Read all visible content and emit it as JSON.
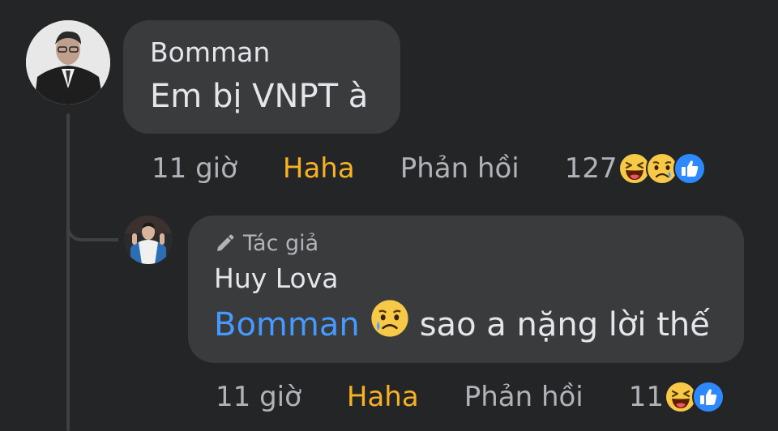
{
  "comment": {
    "author": "Bomman",
    "text": "Em bị VNPT à",
    "time": "11 giờ",
    "reaction_label": "Haha",
    "reply_label": "Phản hồi",
    "reaction_count": "127",
    "reactions": [
      "haha-emoji-icon",
      "sad-emoji-icon",
      "like-icon"
    ]
  },
  "reply": {
    "badge": "Tác giả",
    "author": "Huy Lova",
    "mention": "Bomman",
    "text": "sao a nặng lời thế",
    "time": "11 giờ",
    "reaction_label": "Haha",
    "reply_label": "Phản hồi",
    "reaction_count": "11",
    "reactions": [
      "haha-emoji-icon",
      "like-icon"
    ]
  },
  "colors": {
    "background": "#242526",
    "bubble": "#3a3b3c",
    "mention": "#4599ff",
    "haha": "#f7b125",
    "muted": "#b0b3b8"
  }
}
